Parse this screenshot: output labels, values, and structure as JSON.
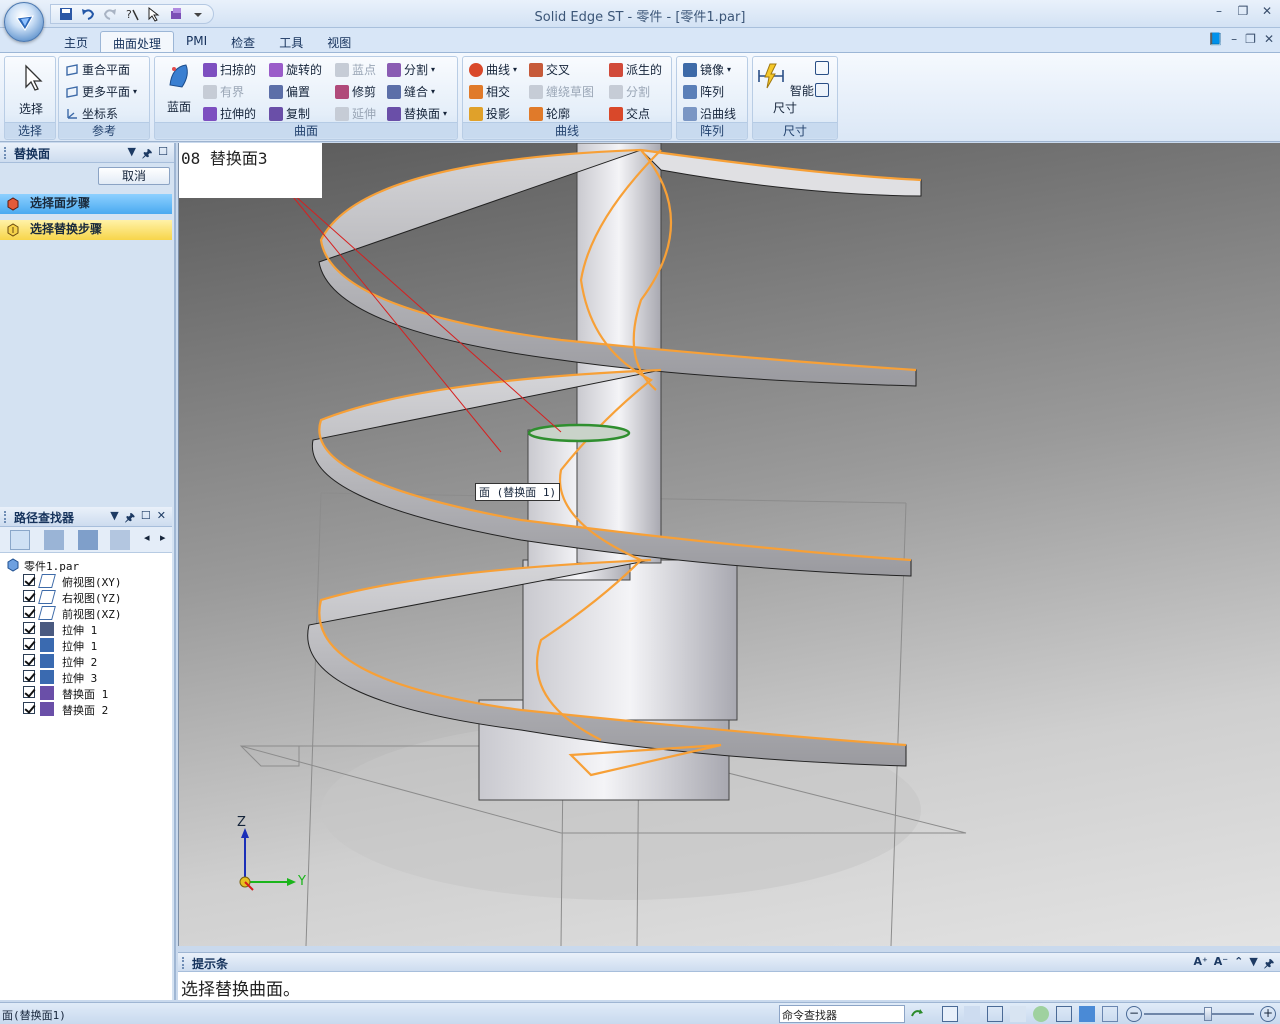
{
  "app": {
    "title": "Solid Edge ST - 零件 - [零件1.par]",
    "window_controls": [
      "–",
      "❐",
      "✕"
    ],
    "doc_controls": [
      "–",
      "❐",
      "✕"
    ]
  },
  "tabs": [
    {
      "label": "主页",
      "active": false
    },
    {
      "label": "曲面处理",
      "active": true
    },
    {
      "label": "PMI",
      "active": false
    },
    {
      "label": "检查",
      "active": false
    },
    {
      "label": "工具",
      "active": false
    },
    {
      "label": "视图",
      "active": false
    }
  ],
  "ribbon": {
    "select_group": {
      "button": "选择",
      "label": "选择"
    },
    "reference_group": {
      "label": "参考",
      "items": [
        "重合平面",
        "更多平面",
        "坐标系"
      ]
    },
    "surface_group": {
      "label": "曲面",
      "big_button": "蓝面",
      "col1": [
        "扫掠的",
        "有界",
        "拉伸的"
      ],
      "col2": [
        "旋转的",
        "偏置",
        "复制"
      ],
      "col3": [
        "蓝点",
        "修剪",
        "延伸"
      ],
      "col4": [
        "分割",
        "缝合",
        "替换面"
      ]
    },
    "curve_group": {
      "label": "曲线",
      "col1": [
        "曲线",
        "相交",
        "投影"
      ],
      "col2": [
        "交叉",
        "缠绕草图",
        "轮廓"
      ],
      "col3": [
        "派生的",
        "分割",
        "交点"
      ]
    },
    "pattern_group": {
      "label": "阵列",
      "items": [
        "镜像",
        "阵列",
        "沿曲线"
      ]
    },
    "dimension_group": {
      "label": "尺寸",
      "big_button": "智能尺寸"
    }
  },
  "command_bar": {
    "title": "替换面",
    "cancel": "取消",
    "steps": [
      "选择面步骤",
      "选择替换步骤"
    ],
    "controls": [
      "▼",
      "🖈",
      "☐"
    ]
  },
  "pathfinder": {
    "title": "路径查找器",
    "controls": [
      "▼",
      "🖈",
      "☐",
      "✕"
    ],
    "root": "零件1.par",
    "items": [
      {
        "label": "俯视图(XY)",
        "icon": "plane-icon"
      },
      {
        "label": "右视图(YZ)",
        "icon": "plane-icon"
      },
      {
        "label": "前视图(XZ)",
        "icon": "plane-icon"
      },
      {
        "label": "拉伸 1",
        "icon": "surface-extrude-icon"
      },
      {
        "label": "拉伸 1",
        "icon": "extrude-icon"
      },
      {
        "label": "拉伸 2",
        "icon": "extrude-icon"
      },
      {
        "label": "拉伸 3",
        "icon": "extrude-icon"
      },
      {
        "label": "替换面 1",
        "icon": "replace-face-icon"
      },
      {
        "label": "替换面 2",
        "icon": "replace-face-icon"
      }
    ]
  },
  "viewport": {
    "label": "08 替换面3",
    "face_tooltip": "面 (替换面 1)",
    "triad": {
      "z": "Z",
      "y": "Y"
    }
  },
  "prompt": {
    "title": "提示条",
    "text": "选择替换曲面。",
    "controls": [
      "A⁺",
      "A⁻",
      "⌃",
      "▼",
      "🖈"
    ]
  },
  "status": {
    "text": "面(替换面1)",
    "command_finder": "命令查找器"
  },
  "colors": {
    "accent": "#f7a037",
    "selected_face": "#2f8f2f",
    "step_blue": "#4aa9f0",
    "step_yellow": "#f7d54a"
  }
}
